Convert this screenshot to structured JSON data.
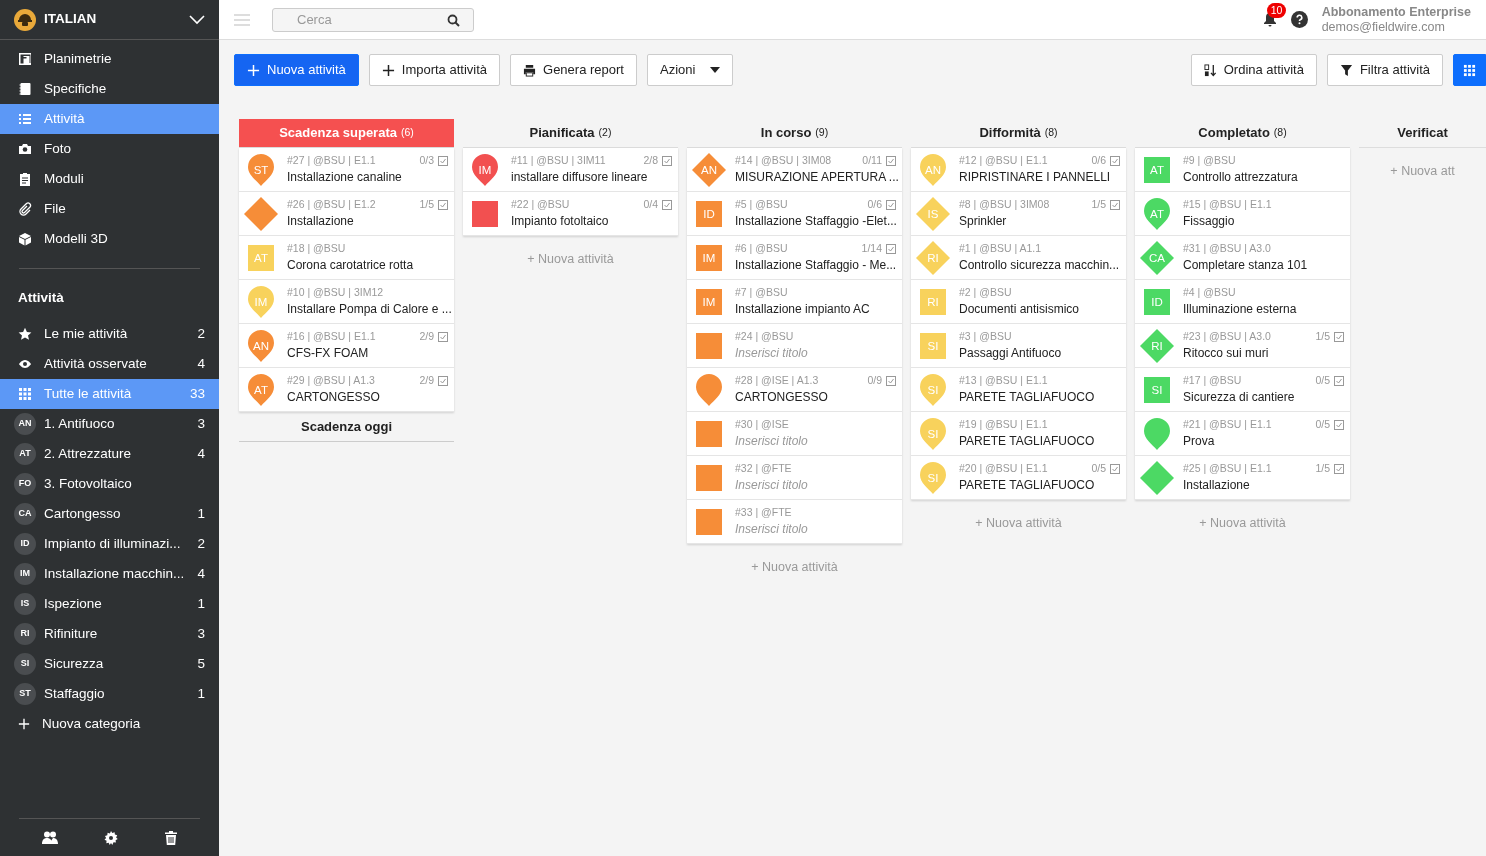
{
  "project": {
    "name": "ITALIAN"
  },
  "nav": [
    {
      "label": "Planimetrie",
      "selected": false
    },
    {
      "label": "Specifiche",
      "selected": false
    },
    {
      "label": "Attività",
      "selected": true
    },
    {
      "label": "Foto",
      "selected": false
    },
    {
      "label": "Moduli",
      "selected": false
    },
    {
      "label": "File",
      "selected": false
    },
    {
      "label": "Modelli 3D",
      "selected": false
    }
  ],
  "filters_heading": "Attività",
  "filters": [
    {
      "label": "Le mie attività",
      "count": "2",
      "selected": false
    },
    {
      "label": "Attività osservate",
      "count": "4",
      "selected": false
    },
    {
      "label": "Tutte le attività",
      "count": "33",
      "selected": true
    }
  ],
  "categories": [
    {
      "initials": "AN",
      "label": "1. Antifuoco",
      "count": "3"
    },
    {
      "initials": "AT",
      "label": "2. Attrezzature",
      "count": "4"
    },
    {
      "initials": "FO",
      "label": "3. Fotovoltaico"
    },
    {
      "initials": "CA",
      "label": "Cartongesso",
      "count": "1"
    },
    {
      "initials": "ID",
      "label": "Impianto di illuminazi...",
      "count": "2"
    },
    {
      "initials": "IM",
      "label": "Installazione macchin...",
      "count": "4"
    },
    {
      "initials": "IS",
      "label": "Ispezione",
      "count": "1"
    },
    {
      "initials": "RI",
      "label": "Rifiniture",
      "count": "3"
    },
    {
      "initials": "SI",
      "label": "Sicurezza",
      "count": "5"
    },
    {
      "initials": "ST",
      "label": "Staffaggio",
      "count": "1"
    }
  ],
  "new_category": "Nuova categoria",
  "search": {
    "placeholder": "Cerca"
  },
  "notifications": "10",
  "account": {
    "plan": "Abbonamento Enterprise",
    "email": "demos@fieldwire.com"
  },
  "toolbar_left": [
    {
      "kind": "create",
      "label": "Nuova attività"
    },
    {
      "kind": "import",
      "label": "Importa attività"
    },
    {
      "kind": "report",
      "label": "Genera report"
    },
    {
      "kind": "dropdown",
      "label": "Azioni"
    }
  ],
  "toolbar_right": [
    {
      "kind": "sort",
      "label": "Ordina attività"
    },
    {
      "kind": "filter",
      "label": "Filtra attività"
    },
    {
      "kind": "view"
    }
  ],
  "columns": [
    {
      "title": "Scadenza superata",
      "count": "(6)",
      "overdue": true,
      "cards": [
        {
          "kind": "pin",
          "color": "#f68d38",
          "initials": "ST",
          "meta": "#27 | @BSU | E1.1",
          "checklist": "0/3",
          "title": "Installazione canaline"
        },
        {
          "kind": "diamond",
          "color": "#f68d38",
          "meta": "#26 | @BSU | E1.2",
          "checklist": "1/5",
          "title": "Installazione"
        },
        {
          "kind": "square",
          "color": "#f8d25c",
          "initials": "AT",
          "meta": "#18 | @BSU",
          "title": "Corona carotatrice rotta"
        },
        {
          "kind": "pin",
          "color": "#f8d25c",
          "initials": "IM",
          "meta": "#10 | @BSU | 3IM12",
          "title": "Installare Pompa di Calore e ..."
        },
        {
          "kind": "pin",
          "color": "#f68d38",
          "initials": "AN",
          "meta": "#16 | @BSU | E1.1",
          "checklist": "2/9",
          "title": "CFS-FX FOAM"
        },
        {
          "kind": "pin",
          "color": "#f68d38",
          "initials": "AT",
          "meta": "#29 | @BSU | A1.3",
          "checklist": "2/9",
          "title": "CARTONGESSO"
        }
      ],
      "subheading": "Scadenza oggi"
    },
    {
      "title": "Pianificata",
      "count": "(2)",
      "overdue": false,
      "cards": [
        {
          "kind": "pin",
          "color": "#f25050",
          "initials": "IM",
          "meta": "#11 | @BSU | 3IM11",
          "checklist": "2/8",
          "title": "installare diffusore lineare"
        },
        {
          "kind": "square",
          "color": "#f25050",
          "meta": "#22 | @BSU",
          "checklist": "0/4",
          "title": "Impianto fotoltaico"
        }
      ],
      "add": "+ Nuova attività"
    },
    {
      "title": "In corso",
      "count": "(9)",
      "overdue": false,
      "cards": [
        {
          "kind": "diamond",
          "color": "#f68d38",
          "initials": "AN",
          "meta": "#14 | @BSU | 3IM08",
          "checklist": "0/11",
          "title": "MISURAZIONE APERTURA ..."
        },
        {
          "kind": "square",
          "color": "#f68d38",
          "initials": "ID",
          "meta": "#5 | @BSU",
          "checklist": "0/6",
          "title": "Installazione Staffaggio -Elet..."
        },
        {
          "kind": "square",
          "color": "#f68d38",
          "initials": "IM",
          "meta": "#6 | @BSU",
          "checklist": "1/14",
          "title": "Installazione Staffaggio - Me..."
        },
        {
          "kind": "square",
          "color": "#f68d38",
          "initials": "IM",
          "meta": "#7 | @BSU",
          "title": "Installazione impianto AC"
        },
        {
          "kind": "square",
          "color": "#f68d38",
          "meta": "#24 | @BSU",
          "placeholder": "Inserisci titolo"
        },
        {
          "kind": "pin",
          "color": "#f68d38",
          "meta": "#28 | @ISE | A1.3",
          "checklist": "0/9",
          "title": "CARTONGESSO"
        },
        {
          "kind": "square",
          "color": "#f68d38",
          "meta": "#30 | @ISE",
          "placeholder": "Inserisci titolo"
        },
        {
          "kind": "square",
          "color": "#f68d38",
          "meta": "#32 | @FTE",
          "placeholder": "Inserisci titolo"
        },
        {
          "kind": "square",
          "color": "#f68d38",
          "meta": "#33 | @FTE",
          "placeholder": "Inserisci titolo"
        }
      ],
      "add": "+ Nuova attività"
    },
    {
      "title": "Difformità",
      "count": "(8)",
      "overdue": false,
      "cards": [
        {
          "kind": "pin",
          "color": "#f8d25c",
          "initials": "AN",
          "meta": "#12 | @BSU | E1.1",
          "checklist": "0/6",
          "title": "RIPRISTINARE I PANNELLI"
        },
        {
          "kind": "diamond",
          "color": "#f8d25c",
          "initials": "IS",
          "meta": "#8 | @BSU | 3IM08",
          "checklist": "1/5",
          "title": "Sprinkler"
        },
        {
          "kind": "diamond",
          "color": "#f8d25c",
          "initials": "RI",
          "meta": "#1 | @BSU | A1.1",
          "title": "Controllo sicurezza macchin..."
        },
        {
          "kind": "square",
          "color": "#f8d25c",
          "initials": "RI",
          "meta": "#2 | @BSU",
          "title": "Documenti antisismico"
        },
        {
          "kind": "square",
          "color": "#f8d25c",
          "initials": "SI",
          "meta": "#3 | @BSU",
          "title": "Passaggi Antifuoco"
        },
        {
          "kind": "pin",
          "color": "#f8d25c",
          "initials": "SI",
          "meta": "#13 | @BSU | E1.1",
          "title": "PARETE TAGLIAFUOCO"
        },
        {
          "kind": "pin",
          "color": "#f8d25c",
          "initials": "SI",
          "meta": "#19 | @BSU | E1.1",
          "title": "PARETE TAGLIAFUOCO"
        },
        {
          "kind": "pin",
          "color": "#f8d25c",
          "initials": "SI",
          "meta": "#20 | @BSU | E1.1",
          "checklist": "0/5",
          "title": "PARETE TAGLIAFUOCO"
        }
      ],
      "add": "+ Nuova attività"
    },
    {
      "title": "Completato",
      "count": "(8)",
      "overdue": false,
      "cards": [
        {
          "kind": "square",
          "color": "#4cd964",
          "initials": "AT",
          "meta": "#9 | @BSU",
          "title": "Controllo attrezzatura"
        },
        {
          "kind": "pin",
          "color": "#4cd964",
          "initials": "AT",
          "meta": "#15 | @BSU | E1.1",
          "title": "Fissaggio"
        },
        {
          "kind": "diamond",
          "color": "#4cd964",
          "initials": "CA",
          "meta": "#31 | @BSU | A3.0",
          "title": "Completare stanza 101"
        },
        {
          "kind": "square",
          "color": "#4cd964",
          "initials": "ID",
          "meta": "#4 | @BSU",
          "title": "Illuminazione esterna"
        },
        {
          "kind": "diamond",
          "color": "#4cd964",
          "initials": "RI",
          "meta": "#23 | @BSU | A3.0",
          "checklist": "1/5",
          "title": "Ritocco sui muri"
        },
        {
          "kind": "square",
          "color": "#4cd964",
          "initials": "SI",
          "meta": "#17 | @BSU",
          "checklist": "0/5",
          "title": "Sicurezza di cantiere"
        },
        {
          "kind": "pin",
          "color": "#4cd964",
          "meta": "#21 | @BSU | E1.1",
          "checklist": "0/5",
          "title": "Prova"
        },
        {
          "kind": "diamond",
          "color": "#4cd964",
          "meta": "#25 | @BSU | E1.1",
          "checklist": "1/5",
          "title": "Installazione"
        }
      ],
      "add": "+ Nuova attività"
    },
    {
      "title": "Verificat",
      "overdue": false,
      "add": "+ Nuova att"
    }
  ]
}
